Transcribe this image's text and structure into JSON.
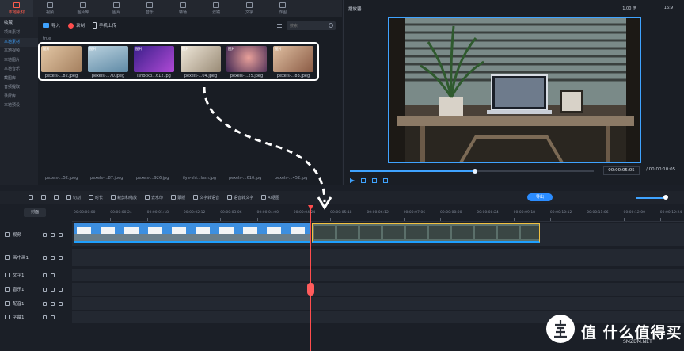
{
  "top_tabs": [
    {
      "label": "本地素材",
      "icon": "folder-icon",
      "active": true
    },
    {
      "label": "视频",
      "icon": "film-icon",
      "active": false
    },
    {
      "label": "图片库",
      "icon": "image-library-icon",
      "active": false
    },
    {
      "label": "图片",
      "icon": "image-icon",
      "active": false
    },
    {
      "label": "音乐",
      "icon": "music-icon",
      "active": false
    },
    {
      "label": "转场",
      "icon": "transition-icon",
      "active": false
    },
    {
      "label": "滤镜",
      "icon": "filter-icon",
      "active": false
    },
    {
      "label": "文字",
      "icon": "text-icon",
      "active": false
    },
    {
      "label": "作图",
      "icon": "draw-icon",
      "active": false
    }
  ],
  "left_nav": {
    "header": "收藏",
    "items": [
      "项目素材",
      "本地素材",
      "本地视频",
      "本地图片",
      "本地音乐",
      "截图库",
      "音频提取",
      "录屏库",
      "本地预设"
    ],
    "active_index": 1
  },
  "media_toolbar": {
    "import": "导入",
    "record": "录制",
    "phone_upload": "手机上传",
    "search_placeholder": "搜索"
  },
  "group_label": "true",
  "thumbnails": [
    {
      "tag": "图片",
      "name": "pexels-...82.jpeg",
      "color": "#c7a98a"
    },
    {
      "tag": "图片",
      "name": "pexels-...70.jpeg",
      "color": "#8fb3c9"
    },
    {
      "tag": "图片",
      "name": "ishockp...612.jpg",
      "color": "#6a3fb5"
    },
    {
      "tag": "图片",
      "name": "pexels-...04.jpeg",
      "color": "#d9d1c4"
    },
    {
      "tag": "图片",
      "name": "pexels-...25.jpeg",
      "color": "#5a3a6e"
    },
    {
      "tag": "图片",
      "name": "pexels-...83.jpeg",
      "color": "#c99a7a"
    }
  ],
  "second_row_files": [
    "pexels-...52.jpeg",
    "pexels-...87.jpeg",
    "pexels-...926.jpg",
    "ilya-shi...lash.jpg",
    "pexels-...610.jpg",
    "pexels-...452.jpg"
  ],
  "preview": {
    "title": "播放器",
    "zoom": "1.00 倍",
    "ratio": "16:9",
    "timecode": "00:00:05:05",
    "separator": "/",
    "duration": "00:00:10:05"
  },
  "timeline_tools": [
    "",
    "",
    "",
    "切割",
    "时长",
    "裁剪和缩放",
    "去水印",
    "蒙版",
    "文字转语音",
    "语音转文字",
    "AI抠图"
  ],
  "export_label": "导出",
  "cover_label": "封面",
  "ruler_labels": [
    "00:00:00:00",
    "00:00:00:24",
    "00:00:01:18",
    "00:00:02:12",
    "00:00:03:06",
    "00:00:04:00",
    "00:00:04:24",
    "00:00:05:18",
    "00:00:06:12",
    "00:00:07:06",
    "00:00:08:00",
    "00:00:08:24",
    "00:00:09:18",
    "00:00:10:12",
    "00:00:11:06",
    "00:00:12:00",
    "00:00:12:24"
  ],
  "tracks": [
    {
      "label": "视频",
      "icon": "video-track-icon"
    },
    {
      "label": "画中画1",
      "icon": "pip-track-icon"
    },
    {
      "label": "文字1",
      "icon": "text-track-icon"
    },
    {
      "label": "音乐1",
      "icon": "music-track-icon"
    },
    {
      "label": "配音1",
      "icon": "voice-track-icon"
    },
    {
      "label": "字幕1",
      "icon": "subtitle-track-icon"
    }
  ],
  "watermark": {
    "title": "值 什么值得买",
    "sub": "SMZDM.NET"
  },
  "colors": {
    "accent": "#3fa3ff",
    "active_tab": "#ff5c4d",
    "playhead": "#ff4d4d",
    "export": "#2b8cff",
    "clip_a": "#2d7fd1",
    "clip_b": "#2a9fb0"
  }
}
